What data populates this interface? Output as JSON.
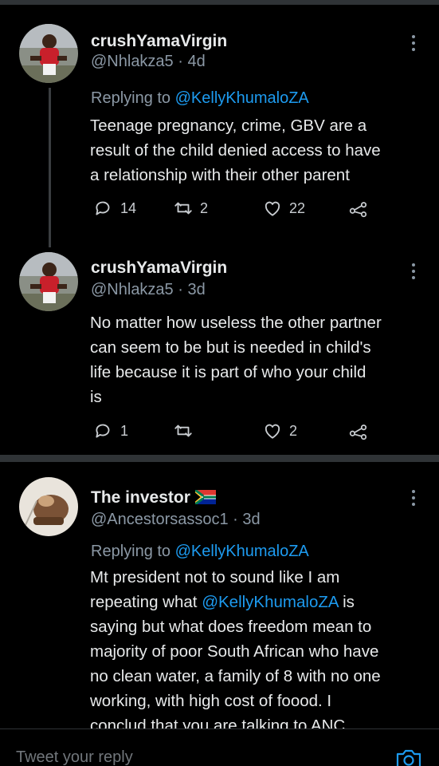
{
  "colors": {
    "background": "#000000",
    "accent": "#1d9bf0",
    "secondary_text": "#8b98a5"
  },
  "tweets": [
    {
      "name": "crushYamaVirgin",
      "handle": "@Nhlakza5 · 4d",
      "replying_prefix": "Replying to ",
      "replying_to": "@KellyKhumaloZA",
      "lines": [
        "Teenage pregnancy, crime, GBV are a",
        "result of the child denied access to have",
        "a relationship with their other parent"
      ],
      "replies": "14",
      "retweets": "2",
      "likes": "22"
    },
    {
      "name": "crushYamaVirgin",
      "handle": "@Nhlakza5 · 3d",
      "lines": [
        "No matter how useless the other partner",
        "can seem to be but is needed in child's",
        "life because it is part of who your child",
        "is"
      ],
      "replies": "1",
      "retweets": "",
      "likes": "2"
    },
    {
      "name": "The investor",
      "flag_icon": "south-africa-flag-icon",
      "handle": "@Ancestorsassoc1 · 3d",
      "replying_prefix": "Replying to ",
      "replying_to": "@KellyKhumaloZA",
      "line1": "Mt president not to sound like I am",
      "line2_pre": "repeating what ",
      "line2_mention": "@KellyKhumaloZA",
      "line2_post": " is",
      "line3": "saying but what does freedom mean to",
      "line4": "majority of poor South African who have",
      "line5": "no clean water, a family of 8 with no one",
      "line6": "working, with high cost of foood. I",
      "line7": "conclud that you are talking to ANC"
    }
  ],
  "reply_bar": {
    "placeholder": "Tweet your reply",
    "icon": "camera-icon"
  }
}
